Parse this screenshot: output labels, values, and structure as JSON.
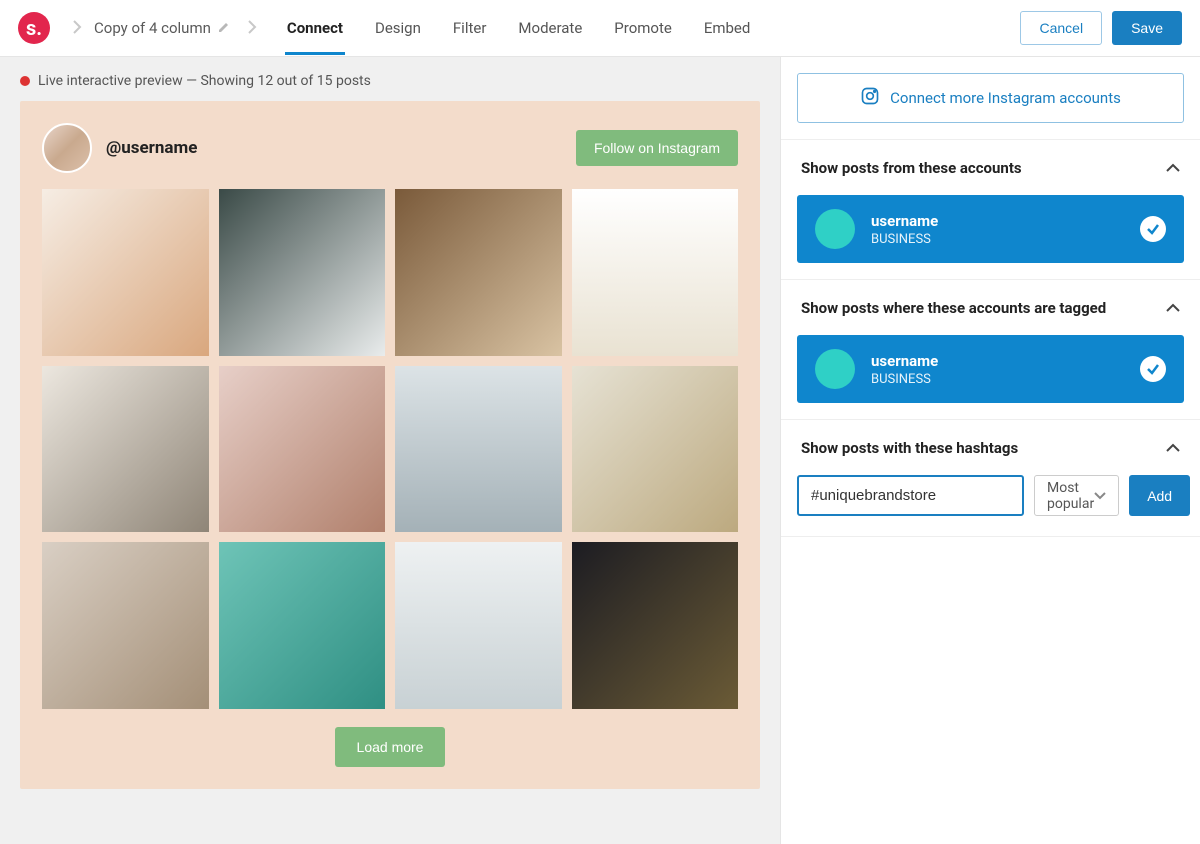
{
  "header": {
    "breadcrumb_title": "Copy of 4 column",
    "tabs": [
      "Connect",
      "Design",
      "Filter",
      "Moderate",
      "Promote",
      "Embed"
    ],
    "active_tab": 0,
    "cancel": "Cancel",
    "save": "Save"
  },
  "preview": {
    "status_text": "Live interactive preview — Showing 12 out of 15 posts",
    "username": "@username",
    "follow_label": "Follow on Instagram",
    "load_more": "Load more",
    "grid_count": 12
  },
  "panel": {
    "connect_more": "Connect more Instagram accounts",
    "sections": {
      "accounts": {
        "title": "Show posts from these accounts",
        "items": [
          {
            "name": "username",
            "type": "BUSINESS",
            "selected": true
          }
        ]
      },
      "tagged": {
        "title": "Show posts where these accounts are tagged",
        "items": [
          {
            "name": "username",
            "type": "BUSINESS",
            "selected": true
          }
        ]
      },
      "hashtags": {
        "title": "Show posts with these hashtags",
        "input_value": "#uniquebrandstore",
        "select_value": "Most popular",
        "add_label": "Add"
      }
    }
  }
}
